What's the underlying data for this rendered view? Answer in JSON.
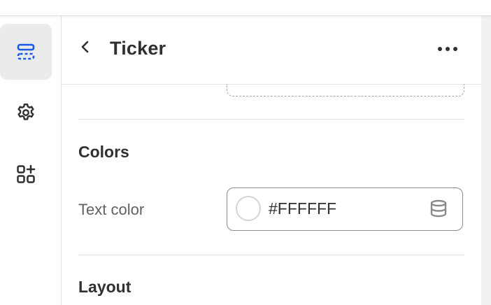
{
  "rail": {
    "items": [
      {
        "icon": "sections-icon",
        "active": true
      },
      {
        "icon": "gear-icon",
        "active": false
      },
      {
        "icon": "apps-add-icon",
        "active": false
      }
    ]
  },
  "header": {
    "title": "Ticker",
    "back_icon": "chevron-left-icon",
    "more_icon": "ellipsis-icon"
  },
  "sections": {
    "colors": {
      "title": "Colors",
      "text_color": {
        "label": "Text color",
        "value": "#FFFFFF",
        "swatch_color": "#FFFFFF"
      }
    },
    "layout": {
      "title": "Layout"
    }
  },
  "colors": {
    "active_icon": "#1a5ae8",
    "icon": "#303030",
    "active_bg": "#ebebeb"
  }
}
